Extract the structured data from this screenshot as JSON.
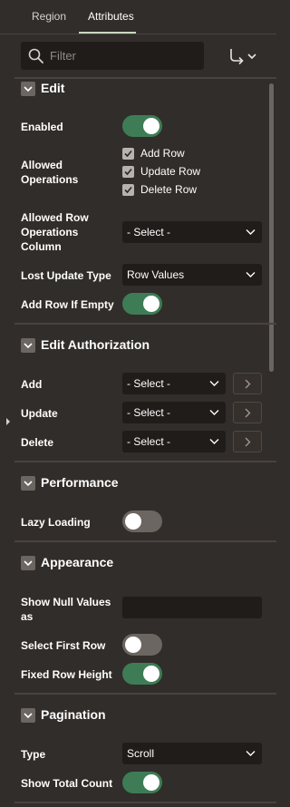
{
  "tabs": [
    {
      "label": "Region",
      "active": false
    },
    {
      "label": "Attributes",
      "active": true
    }
  ],
  "filter": {
    "placeholder": "Filter",
    "value": ""
  },
  "colors": {
    "background": "#312d2a",
    "input_bg": "#1f1c1a",
    "toggle_on": "#3e7c56",
    "toggle_off": "#6b6661"
  },
  "sections": {
    "edit": {
      "title": "Edit",
      "enabled_label": "Enabled",
      "enabled": true,
      "allowed_ops_label": "Allowed Operations",
      "allowed_ops": [
        {
          "label": "Add Row",
          "checked": true
        },
        {
          "label": "Update Row",
          "checked": true
        },
        {
          "label": "Delete Row",
          "checked": true
        }
      ],
      "ops_column_label": "Allowed Row Operations Column",
      "ops_column_value": "- Select -",
      "lost_update_label": "Lost Update Type",
      "lost_update_value": "Row Values",
      "add_row_if_empty_label": "Add Row If Empty",
      "add_row_if_empty": true
    },
    "edit_authorization": {
      "title": "Edit Authorization",
      "add_label": "Add",
      "add_value": "- Select -",
      "update_label": "Update",
      "update_value": "- Select -",
      "delete_label": "Delete",
      "delete_value": "- Select -"
    },
    "performance": {
      "title": "Performance",
      "lazy_loading_label": "Lazy Loading",
      "lazy_loading": false
    },
    "appearance": {
      "title": "Appearance",
      "show_null_label": "Show Null Values as",
      "show_null_value": "",
      "select_first_row_label": "Select First Row",
      "select_first_row": false,
      "fixed_row_height_label": "Fixed Row Height",
      "fixed_row_height": true
    },
    "pagination": {
      "title": "Pagination",
      "type_label": "Type",
      "type_value": "Scroll",
      "show_total_label": "Show Total Count",
      "show_total": true
    }
  }
}
